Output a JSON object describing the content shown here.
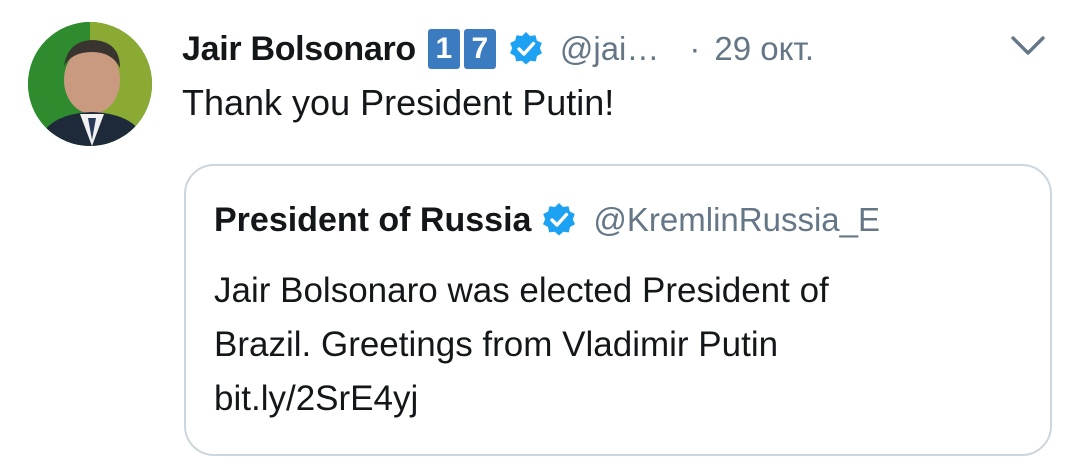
{
  "tweet": {
    "author_name": "Jair Bolsonaro",
    "badges": [
      "1",
      "7"
    ],
    "handle": "@jai…",
    "separator": "·",
    "timestamp": "29 окт.",
    "text": "Thank you President Putin!",
    "icons": {
      "verified": "verified-badge-icon",
      "menu": "chevron-down-icon"
    }
  },
  "quoted_tweet": {
    "author_name": "President of Russia",
    "handle": "@KremlinRussia_E",
    "text_lines": [
      "Jair Bolsonaro was elected President of",
      "Brazil. Greetings from Vladimir Putin",
      "bit.ly/2SrE4yj"
    ]
  },
  "colors": {
    "verified_blue": "#1da1f2",
    "badge_blue": "#3b7bbf",
    "secondary_text": "#657786",
    "card_border": "#ccd6dd"
  }
}
